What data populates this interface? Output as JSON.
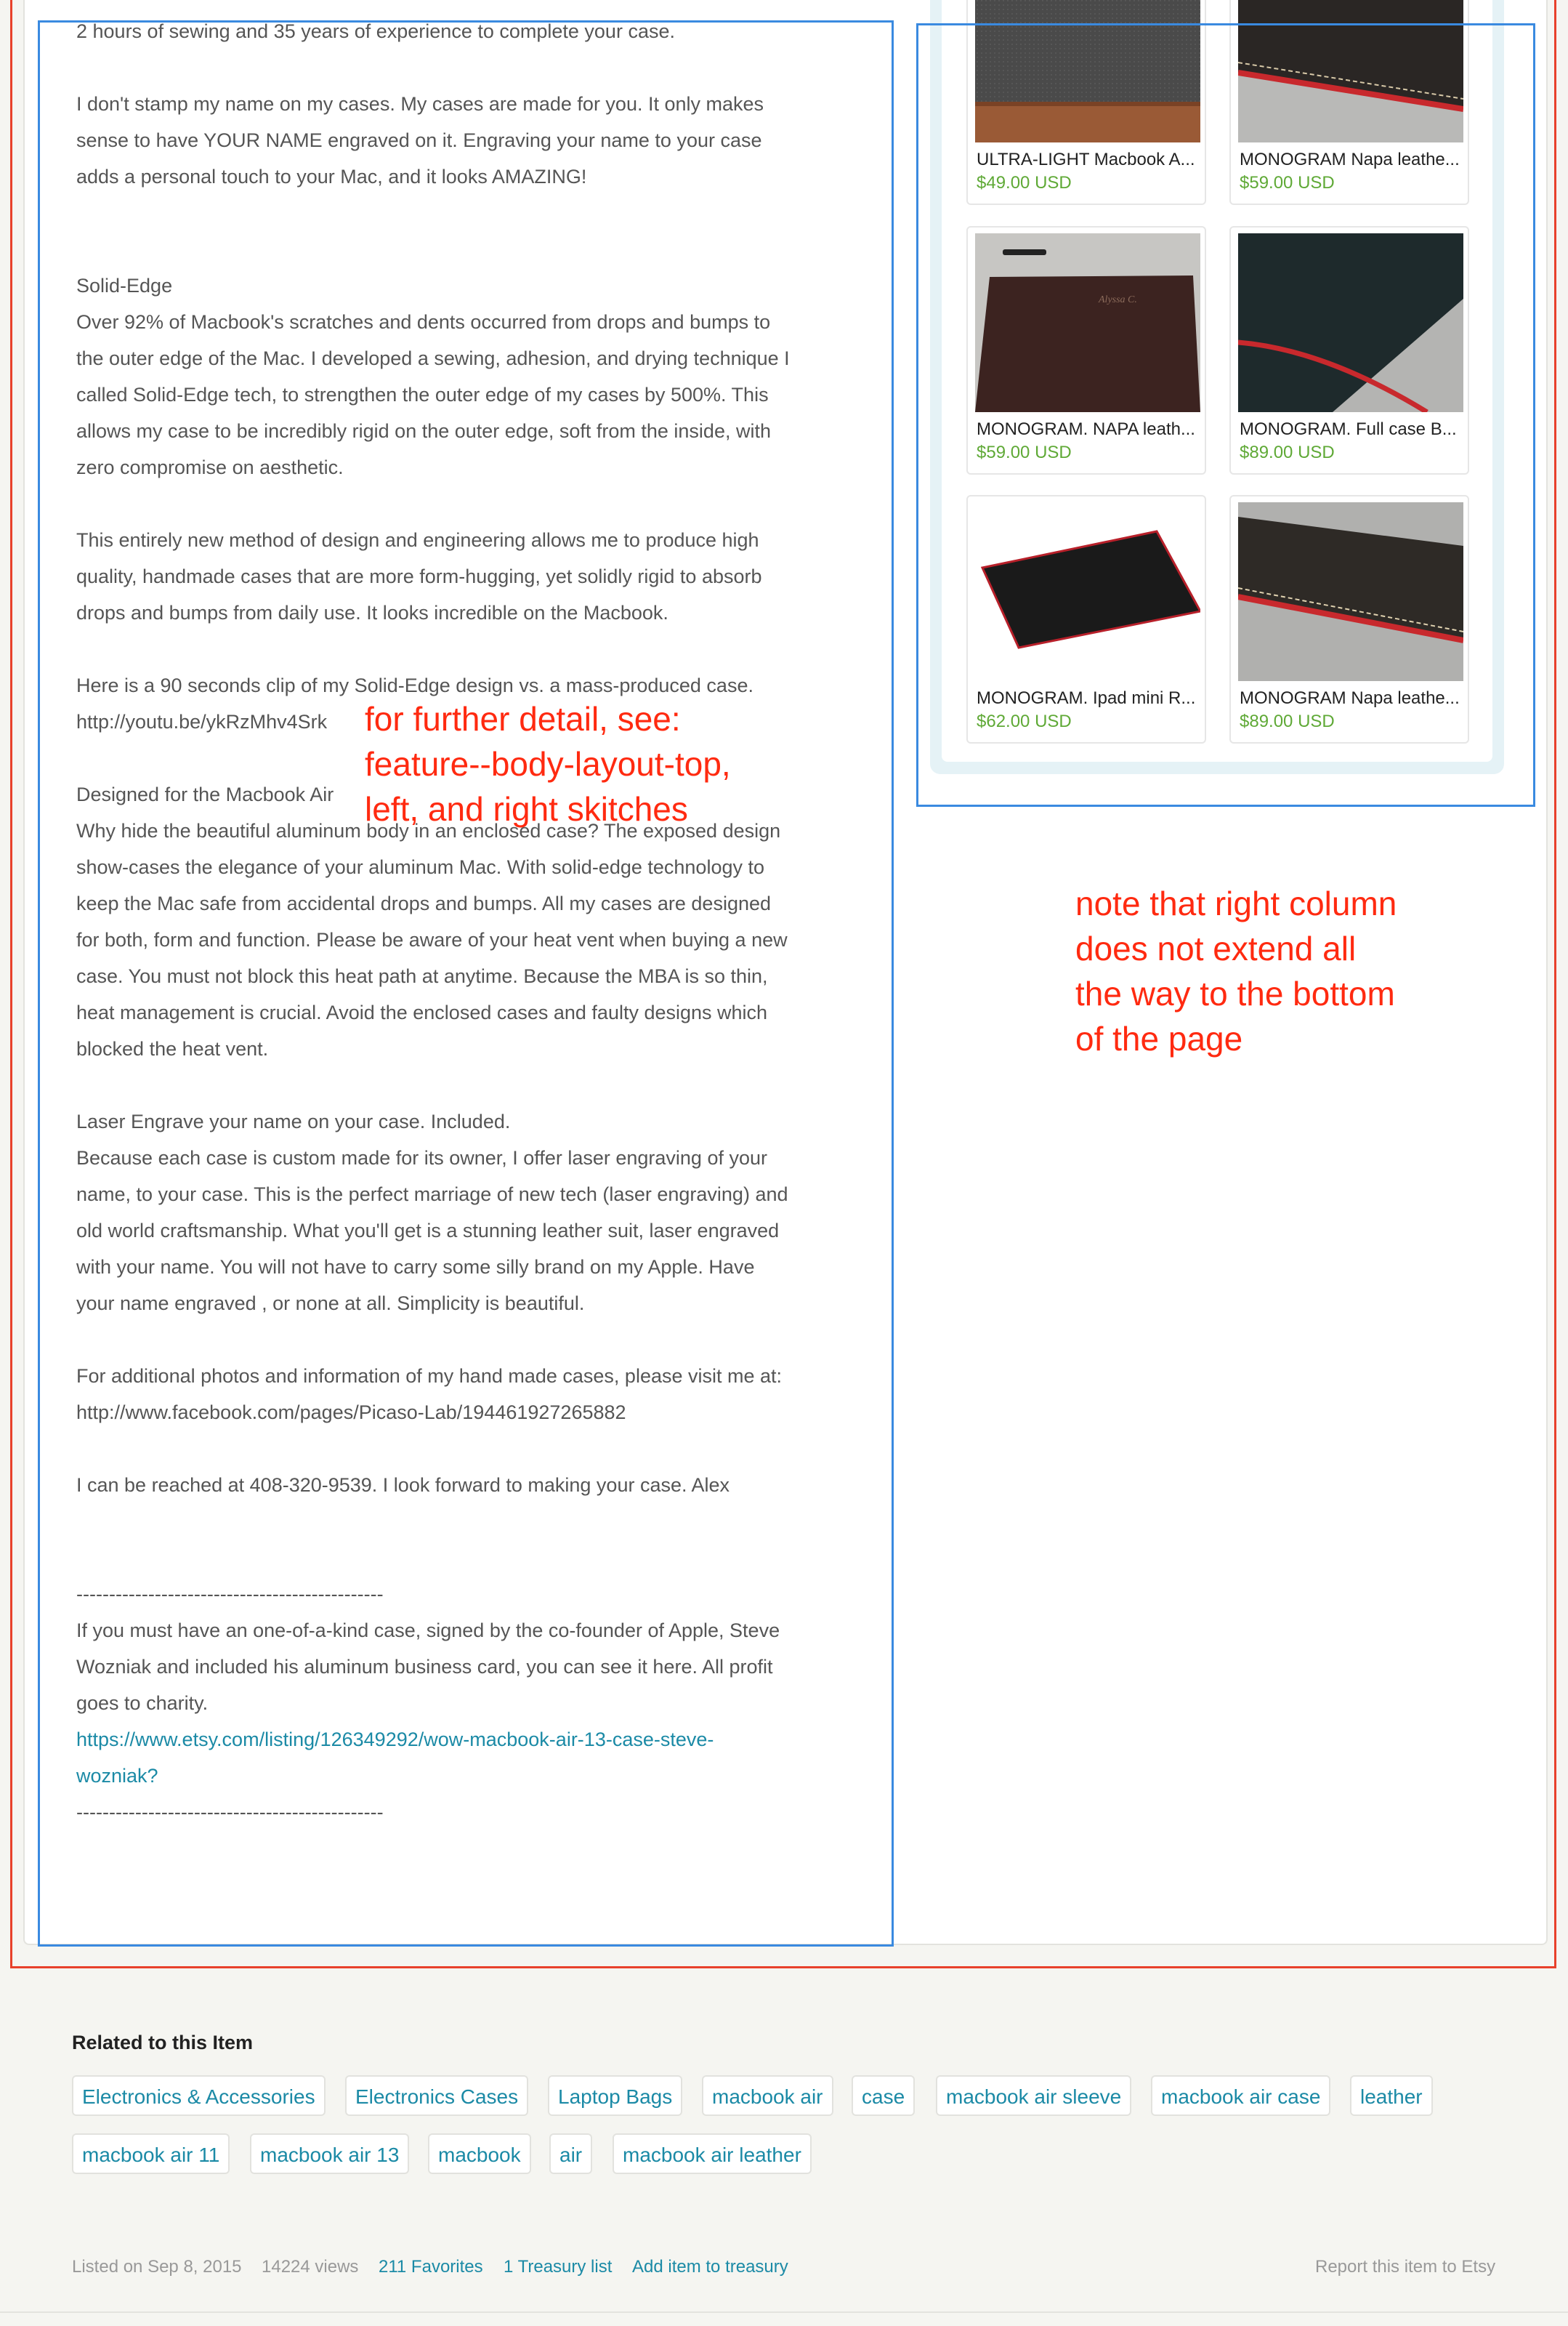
{
  "description": {
    "p0": "2 hours of sewing and 35 years of experience to complete your case.",
    "p1": "I don't stamp my name on my cases. My cases are made for you. It only makes\nsense to have YOUR NAME engraved on it. Engraving your name to your case\nadds a personal touch to your Mac, and it looks AMAZING!",
    "p2": "Solid-Edge\nOver 92% of Macbook's scratches and dents occurred from drops and bumps to\nthe outer edge of the Mac. I developed a sewing, adhesion, and drying technique I\ncalled Solid-Edge tech, to strengthen the outer edge of my cases by 500%. This\nallows my case to be incredibly rigid on the outer edge, soft from the inside, with\nzero compromise on aesthetic.",
    "p3": "This entirely new method of design and engineering allows me to produce high\nquality, handmade cases that are more form-hugging, yet solidly rigid to absorb\ndrops and bumps from daily use. It looks incredible on the Macbook.",
    "p4": "Here is a 90 seconds clip of my Solid-Edge design vs. a mass-produced case.\nhttp://youtu.be/ykRzMhv4Srk",
    "p5": "Designed for the Macbook Air\nWhy hide the beautiful aluminum body in an enclosed case? The exposed design\nshow-cases the elegance of your aluminum Mac. With solid-edge technology to\nkeep the Mac safe from accidental drops and bumps. All my cases are designed\nfor both, form and function. Please be aware of your heat vent when buying a new\ncase. You must not block this heat path at anytime. Because the MBA is so thin,\nheat management is crucial. Avoid the enclosed cases and faulty designs which\nblocked the heat vent.",
    "p6": "Laser Engrave your name on your case. Included.\nBecause each case is custom made for its owner, I offer laser engraving of your\nname, to your case. This is the perfect marriage of new tech (laser engraving) and\nold world craftsmanship. What you'll get is a stunning leather suit, laser engraved\nwith your name. You will not have to carry some silly brand on my Apple. Have\nyour name engraved , or none at all. Simplicity is beautiful.",
    "p7": "For additional photos and information of my hand made cases, please visit me at:\nhttp://www.facebook.com/pages/Picaso-Lab/194461927265882",
    "p8": "I can be reached at 408-320-9539. I look forward to making your case. Alex",
    "divider": "-----------------------------------------------",
    "p9": "If you must have an one-of-a-kind case, signed by the co-founder of Apple, Steve\nWozniak and included his aluminum business card, you can see it here. All profit\ngoes to charity.",
    "link": "https://www.etsy.com/listing/126349292/wow-macbook-air-13-case-steve-\nwozniak?"
  },
  "annotations": {
    "left": "for further detail, see:\nfeature--body-layout-top,\nleft, and right skitches",
    "right": "note that right column\ndoes not extend all\nthe way to the bottom\nof the page"
  },
  "related_listings": [
    {
      "title": "ULTRA-LIGHT Macbook A...",
      "price": "$49.00 USD"
    },
    {
      "title": "MONOGRAM Napa leathe...",
      "price": "$59.00 USD"
    },
    {
      "title": "MONOGRAM. NAPA leath...",
      "price": "$59.00 USD"
    },
    {
      "title": "MONOGRAM. Full case B...",
      "price": "$89.00 USD"
    },
    {
      "title": "MONOGRAM. Ipad mini R...",
      "price": "$62.00 USD"
    },
    {
      "title": "MONOGRAM Napa leathe...",
      "price": "$89.00 USD"
    }
  ],
  "related": {
    "heading": "Related to this Item",
    "tags": [
      "Electronics & Accessories",
      "Electronics Cases",
      "Laptop Bags",
      "macbook air",
      "case",
      "macbook air sleeve",
      "macbook air case",
      "leather",
      "macbook air 11",
      "macbook air 13",
      "macbook",
      "air",
      "macbook air leather"
    ]
  },
  "footer": {
    "listed": "Listed on Sep 8, 2015",
    "views": "14224 views",
    "favorites": "211 Favorites",
    "treasury": "1 Treasury list",
    "add_treasury": "Add item to treasury",
    "report": "Report this item to Etsy"
  },
  "colors": {
    "link": "#1b8aa6",
    "price": "#5fa936",
    "annotation": "#ff2a10",
    "wireframe": "#3a8ae0"
  }
}
